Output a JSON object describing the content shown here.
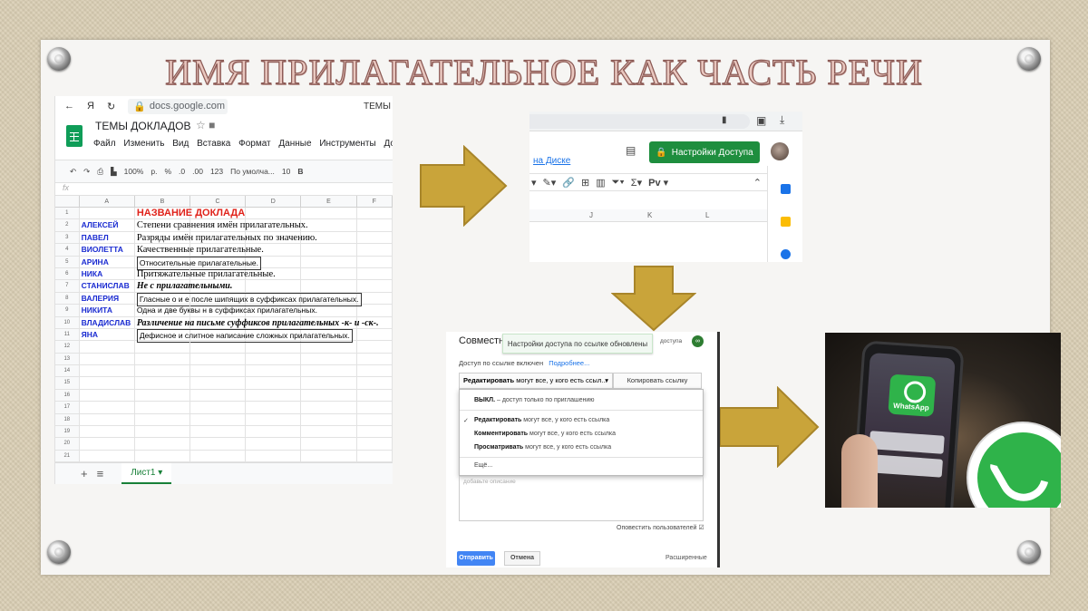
{
  "title": "ИМЯ ПРИЛАГАТЕЛЬНОЕ КАК ЧАСТЬ РЕЧИ",
  "sheets": {
    "browser": {
      "url": "docs.google.com",
      "tab_title": "ТЕМЫ",
      "yandex": "Я"
    },
    "doc_title": "ТЕМЫ ДОКЛАДОВ",
    "menus": [
      "Файл",
      "Изменить",
      "Вид",
      "Вставка",
      "Формат",
      "Данные",
      "Инструменты",
      "Дополн"
    ],
    "toolbar": {
      "zoom": "100%",
      "currency": "р.",
      "percent": "%",
      "dec_less": ".0",
      "dec_more": ".00",
      "format": "123",
      "font": "По умолча...",
      "size": "10",
      "bold": "B"
    },
    "fx": "fx",
    "columns": [
      "A",
      "B",
      "C",
      "D",
      "E",
      "F"
    ],
    "rows": [
      {
        "n": "1",
        "name": "",
        "topic": "НАЗВАНИЕ ДОКЛАДА"
      },
      {
        "n": "2",
        "name": "АЛЕКСЕЙ",
        "topic": "Степени сравнения имён прилагательных."
      },
      {
        "n": "3",
        "name": "ПАВЕЛ",
        "topic": "Разряды имён прилагательных по значению."
      },
      {
        "n": "4",
        "name": "ВИОЛЕТТА",
        "topic": "Качественные прилагательные."
      },
      {
        "n": "5",
        "name": "АРИНА",
        "topic": "Относительные прилагательные."
      },
      {
        "n": "6",
        "name": "НИКА",
        "topic": "Притяжательные прилагательные."
      },
      {
        "n": "7",
        "name": "СТАНИСЛАВ",
        "topic": "Не с прилагательными."
      },
      {
        "n": "8",
        "name": "ВАЛЕРИЯ",
        "topic": "Гласные о и е после шипящих в суффиксах прилагательных."
      },
      {
        "n": "9",
        "name": "НИКИТА",
        "topic": "Одна и две буквы н в суффиксах прилагательных."
      },
      {
        "n": "10",
        "name": "ВЛАДИСЛАВ",
        "topic": "Различение на письме суффиксов прилагательных -к- и -ск-."
      },
      {
        "n": "11",
        "name": "ЯНА",
        "topic": "Дефисное и слитное написание сложных прилагательных."
      }
    ],
    "empty_rows": [
      "12",
      "13",
      "14",
      "15",
      "16",
      "17",
      "18",
      "19",
      "20",
      "21"
    ],
    "sheet_tab": "Лист1",
    "add": "+"
  },
  "drive": {
    "access_button": "Настройки Доступа",
    "disk_link": "на Диске",
    "font_btn": "Рv",
    "columns": [
      "J",
      "K",
      "L"
    ]
  },
  "share": {
    "title": "Совместный",
    "toast": "Настройки доступа по ссылке обновлены",
    "access_right": "доступа",
    "link_enabled": "Доступ по ссылке включен",
    "more": "Подробнее...",
    "select_value_bold": "Редактировать",
    "select_value_rest": "могут все, у кого есть ссыл...",
    "copy_link": "Копировать ссылку",
    "options": [
      {
        "bold": "ВЫКЛ.",
        "rest": " – доступ только по приглашению"
      },
      {
        "bold": "Редактировать",
        "rest": " могут все, у кого есть ссылка"
      },
      {
        "bold": "Комментировать",
        "rest": " могут все, у кого есть ссылка"
      },
      {
        "bold": "Просматривать",
        "rest": " могут все, у кого есть ссылка"
      }
    ],
    "more_options": "Ещё...",
    "message_placeholder": "добавьте описание",
    "notify": "Оповестить пользователей",
    "send": "Отправить",
    "cancel": "Отмена",
    "advanced": "Расширенные"
  },
  "whatsapp": {
    "label": "WhatsApp",
    "brand_color": "#2fb34a"
  },
  "colors": {
    "arrow": "#c9a43a",
    "arrow_edge": "#a8852a",
    "sheets_green": "#0f9d58",
    "drive_green": "#1e8e3e",
    "name_blue": "#1a2bd1",
    "header_red": "#e0221a"
  }
}
